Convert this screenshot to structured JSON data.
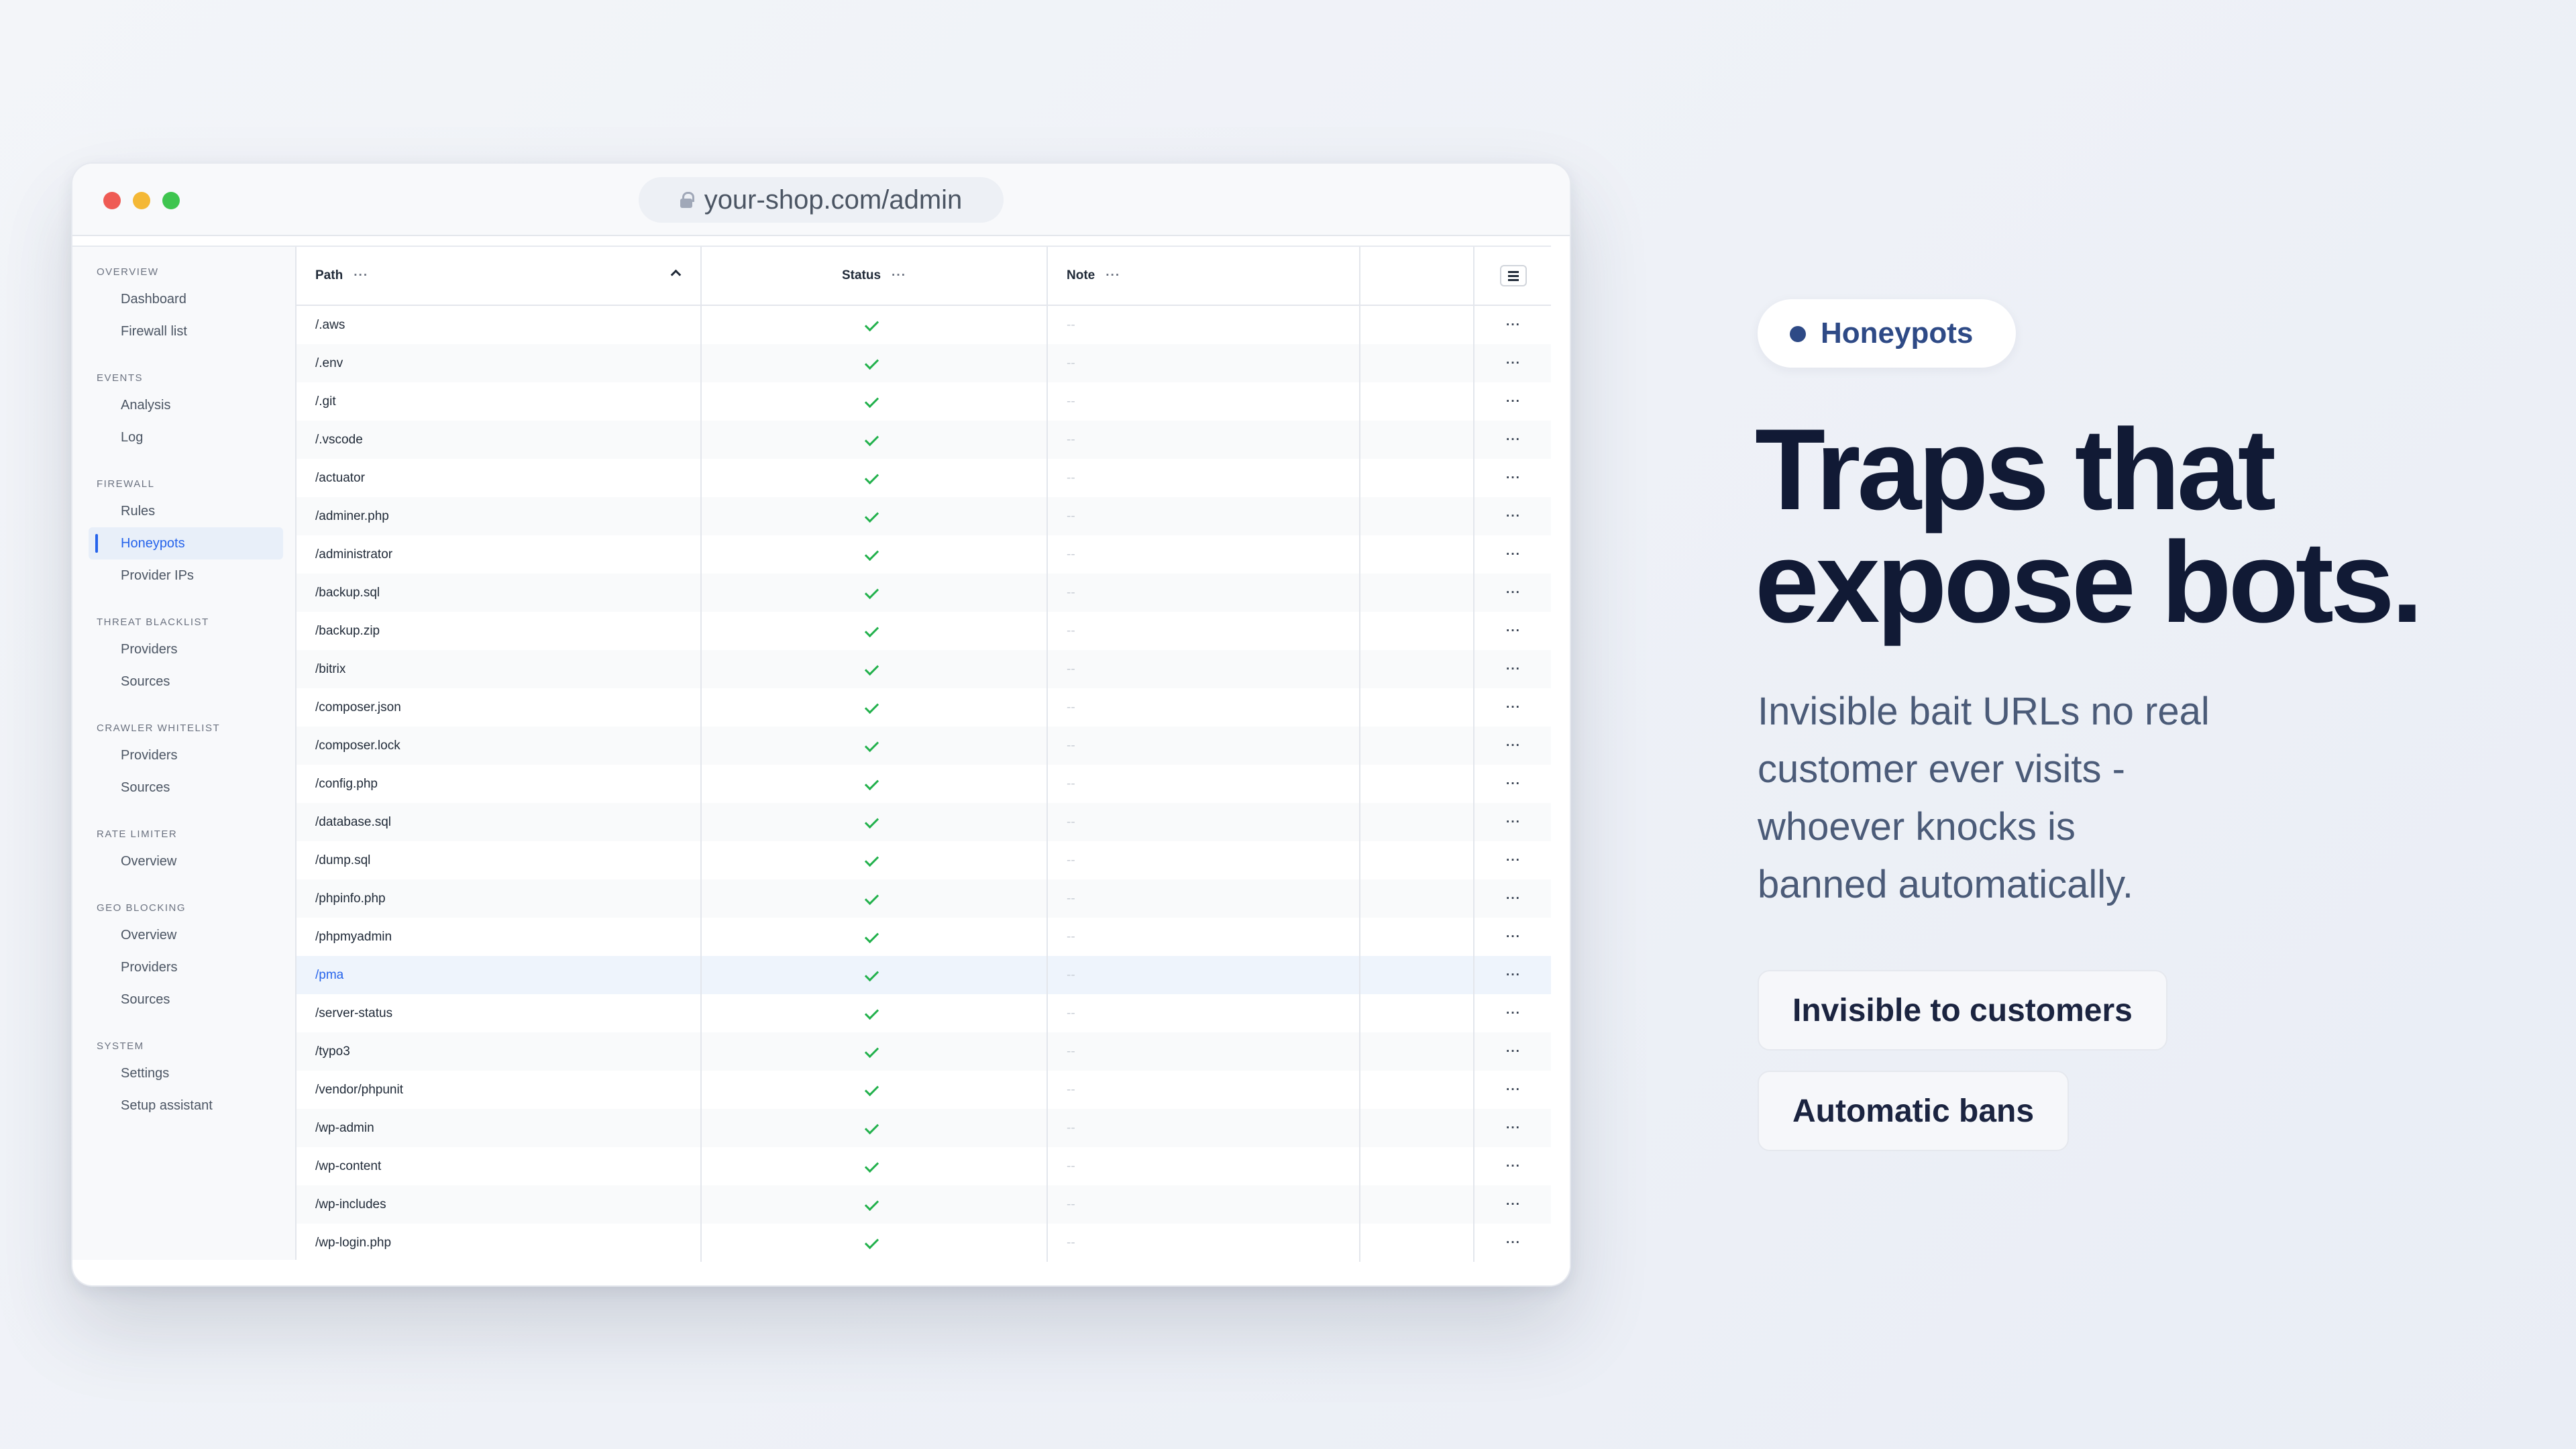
{
  "browser": {
    "url": "your-shop.com/admin"
  },
  "sidebar": {
    "sections": [
      {
        "heading": "OVERVIEW",
        "items": [
          "Dashboard",
          "Firewall list"
        ]
      },
      {
        "heading": "EVENTS",
        "items": [
          "Analysis",
          "Log"
        ]
      },
      {
        "heading": "FIREWALL",
        "items": [
          "Rules",
          "Honeypots",
          "Provider IPs"
        ]
      },
      {
        "heading": "THREAT BLACKLIST",
        "items": [
          "Providers",
          "Sources"
        ]
      },
      {
        "heading": "CRAWLER WHITELIST",
        "items": [
          "Providers",
          "Sources"
        ]
      },
      {
        "heading": "RATE LIMITER",
        "items": [
          "Overview"
        ]
      },
      {
        "heading": "GEO BLOCKING",
        "items": [
          "Overview",
          "Providers",
          "Sources"
        ]
      },
      {
        "heading": "SYSTEM",
        "items": [
          "Settings",
          "Setup assistant"
        ]
      }
    ],
    "active_item": "Honeypots"
  },
  "table": {
    "columns": {
      "path": "Path",
      "status": "Status",
      "note": "Note"
    },
    "header_dots": "···",
    "row_actions": "···",
    "empty_note": "--",
    "highlighted_row": "/pma",
    "rows": [
      "/.aws",
      "/.env",
      "/.git",
      "/.vscode",
      "/actuator",
      "/adminer.php",
      "/administrator",
      "/backup.sql",
      "/backup.zip",
      "/bitrix",
      "/composer.json",
      "/composer.lock",
      "/config.php",
      "/database.sql",
      "/dump.sql",
      "/phpinfo.php",
      "/phpmyadmin",
      "/pma",
      "/server-status",
      "/typo3",
      "/vendor/phpunit",
      "/wp-admin",
      "/wp-content",
      "/wp-includes",
      "/wp-login.php"
    ]
  },
  "marketing": {
    "pill": "Honeypots",
    "headline_line1": "Traps that",
    "headline_line2": "expose bots.",
    "sub_line1": "Invisible bait URLs no real",
    "sub_line2": "customer ever visits -",
    "sub_line3": "whoever knocks is",
    "sub_line4": "banned automatically.",
    "chip1": "Invisible to customers",
    "chip2": "Automatic bans"
  },
  "colors": {
    "accent": "#2563eb",
    "check": "#22b14c",
    "headline": "#111a35",
    "pill_text": "#2e4a86"
  }
}
